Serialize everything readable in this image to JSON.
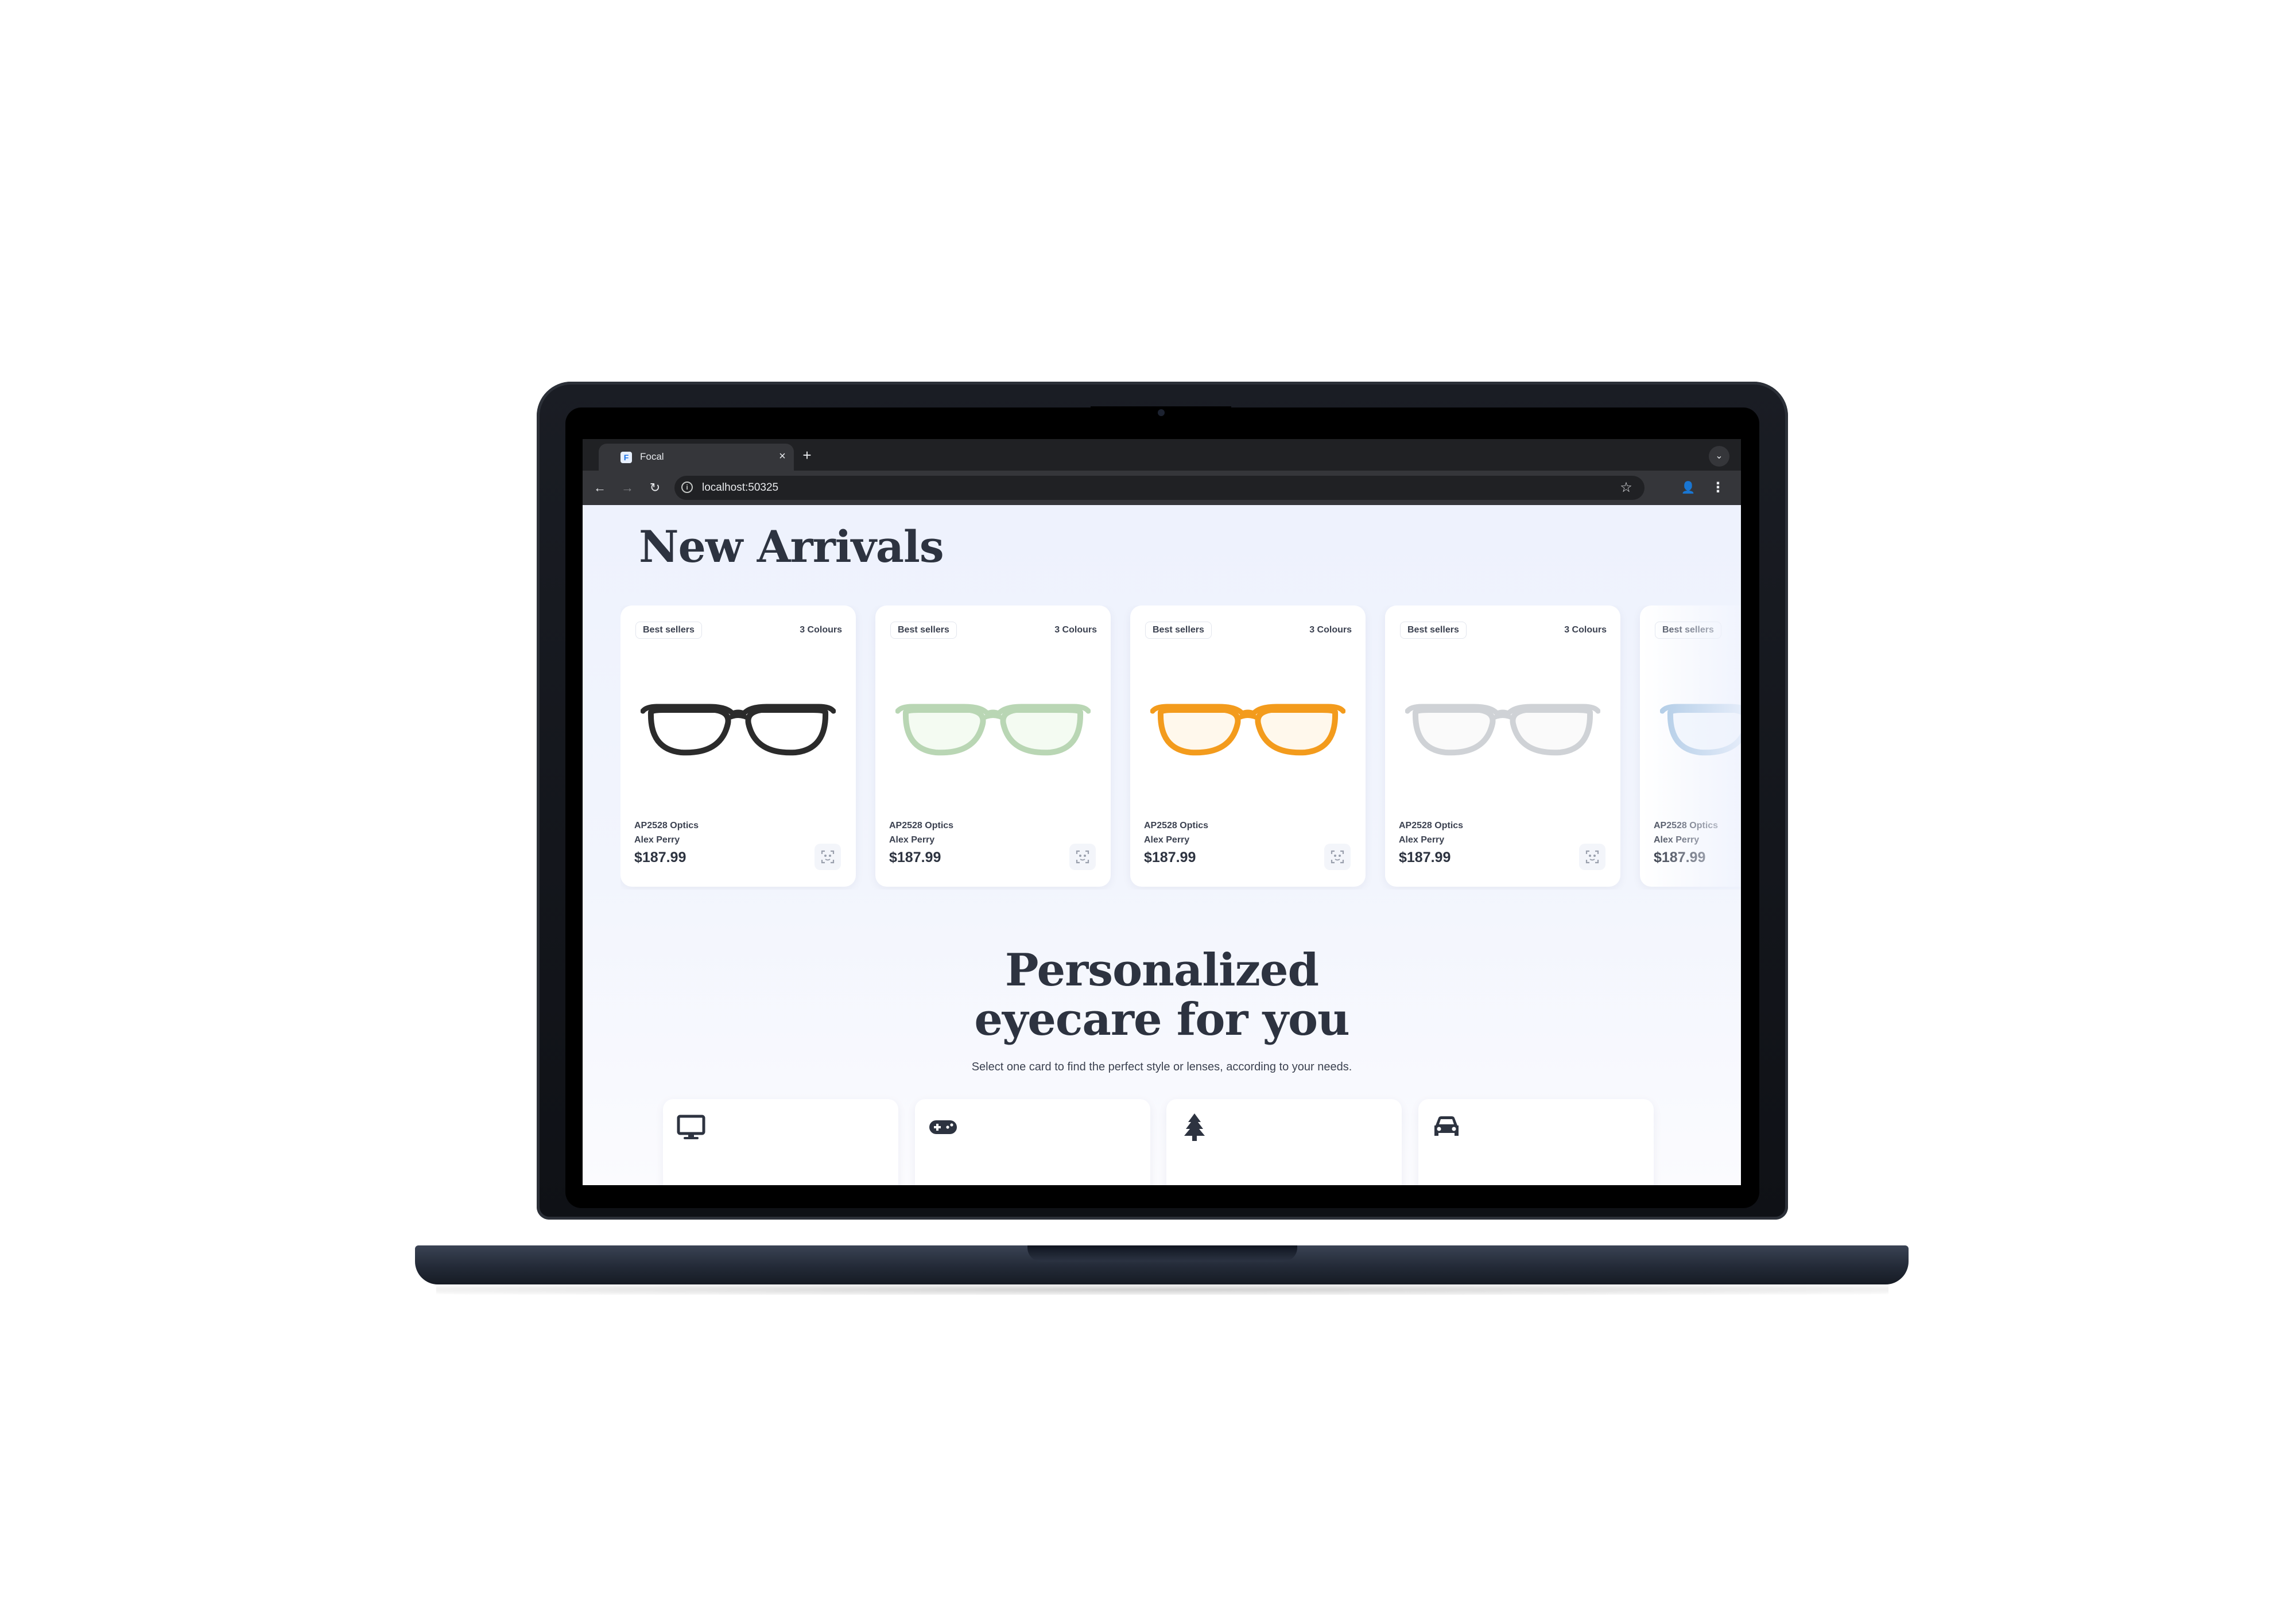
{
  "browser": {
    "tab_title": "Focal",
    "favicon_glyph": "F",
    "new_tab_label": "+",
    "tab_close_label": "×",
    "url": "localhost:50325"
  },
  "page": {
    "section_title": "New Arrivals",
    "products": [
      {
        "badge": "Best sellers",
        "colours": "3 Colours",
        "brand": "AP2528 Optics",
        "designer": "Alex Perry",
        "price": "$187.99",
        "frame_color": "#2b2b2b",
        "lens_tint": "#ffffff"
      },
      {
        "badge": "Best sellers",
        "colours": "3 Colours",
        "brand": "AP2528 Optics",
        "designer": "Alex Perry",
        "price": "$187.99",
        "frame_color": "#b9d6b4",
        "lens_tint": "#f4fbf2"
      },
      {
        "badge": "Best sellers",
        "colours": "3 Colours",
        "brand": "AP2528 Optics",
        "designer": "Alex Perry",
        "price": "$187.99",
        "frame_color": "#f39b1c",
        "lens_tint": "#fff8ec"
      },
      {
        "badge": "Best sellers",
        "colours": "3 Colours",
        "brand": "AP2528 Optics",
        "designer": "Alex Perry",
        "price": "$187.99",
        "frame_color": "#cfd2d6",
        "lens_tint": "#fafafa"
      },
      {
        "badge": "Best sellers",
        "colours": "",
        "brand": "AP2528 Optics",
        "designer": "Alex Perry",
        "price": "$187.99",
        "frame_color": "#a9c7e3",
        "lens_tint": "#f3f8fd"
      }
    ],
    "personal_title_line1": "Personalized",
    "personal_title_line2": "eyecare for you",
    "personal_subtitle": "Select one card to find the perfect style or lenses, according to your needs.",
    "need_cards": [
      {
        "icon": "monitor-icon"
      },
      {
        "icon": "gamepad-icon"
      },
      {
        "icon": "tree-icon"
      },
      {
        "icon": "car-icon"
      }
    ]
  },
  "colors": {
    "text_dark": "#2d3340",
    "page_bg": "#eef2fd",
    "chrome_dark": "#202124",
    "chrome_mid": "#35363a"
  }
}
